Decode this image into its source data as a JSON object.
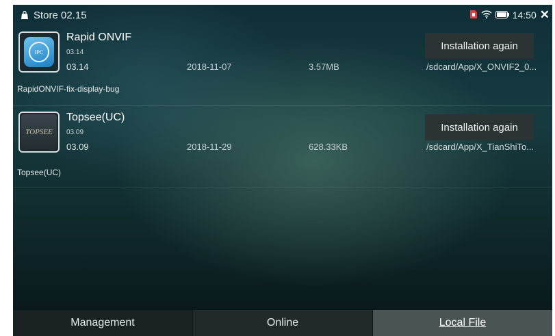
{
  "statusbar": {
    "title": "Store 02.15",
    "time": "14:50",
    "icons": [
      "shopping-bag-icon",
      "sim-alert-icon",
      "wifi-icon",
      "battery-icon",
      "close-icon"
    ],
    "close_label": "✕"
  },
  "apps": [
    {
      "name": "Rapid ONVIF",
      "version_small": "03.14",
      "version": "03.14",
      "date": "2018-11-07",
      "size": "3.57MB",
      "path": "/sdcard/App/X_ONVIF2_0...",
      "description": "RapidONVIF-fix-display-bug",
      "button_label": "Installation again",
      "icon_text": "IPC"
    },
    {
      "name": "Topsee(UC)",
      "version_small": "03.09",
      "version": "03.09",
      "date": "2018-11-29",
      "size": "628.33KB",
      "path": "/sdcard/App/X_TianShiTo...",
      "description": "Topsee(UC)",
      "button_label": "Installation again",
      "icon_text": "TOPSEE"
    }
  ],
  "nav": {
    "tabs": [
      {
        "label": "Management"
      },
      {
        "label": "Online"
      },
      {
        "label": "Local File"
      }
    ],
    "active": "Local File"
  },
  "colors": {
    "accent_button": "#2b3335",
    "active_tab": "#4a5453",
    "alert_red": "#e23b3b"
  }
}
